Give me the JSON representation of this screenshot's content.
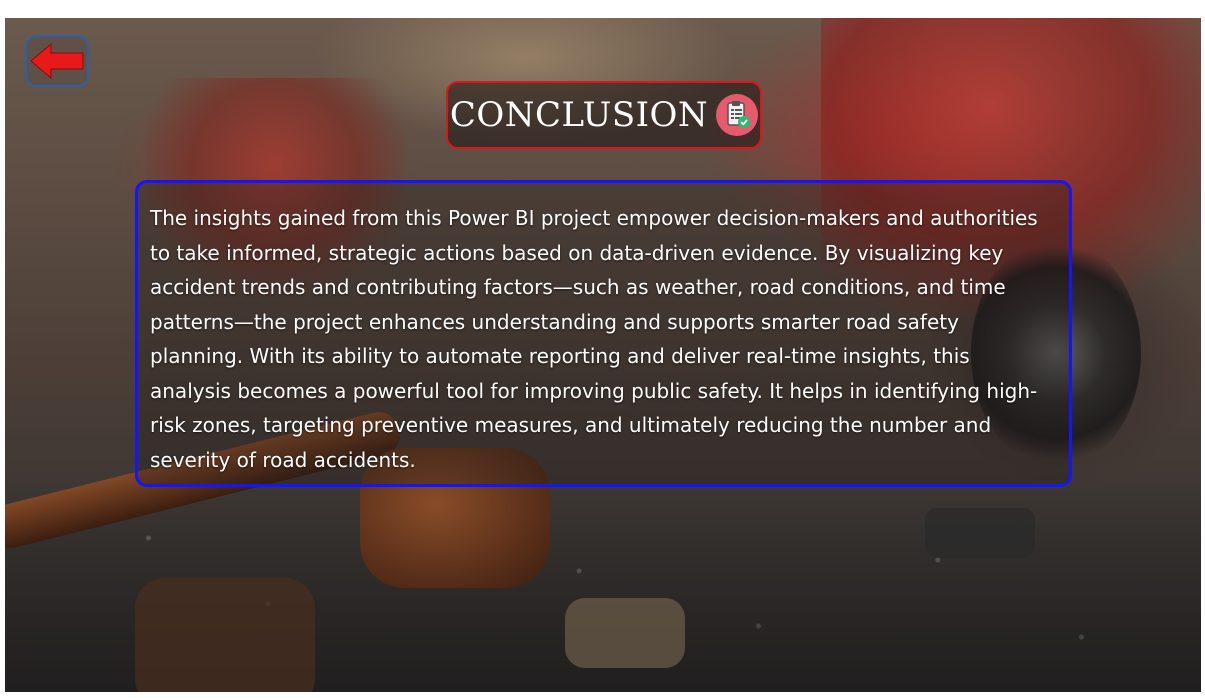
{
  "navigation": {
    "back_icon": "arrow-left-icon",
    "back_icon_color": "#e81919"
  },
  "header": {
    "title": "CONCLUSION",
    "title_icon": "clipboard-check-icon",
    "title_border_color": "#e0141a"
  },
  "content": {
    "paragraph": "The insights gained from this Power BI project empower decision-makers and authorities to take informed, strategic actions based on data-driven evidence. By visualizing key accident trends and contributing factors—such as weather, road conditions, and time patterns—the project enhances understanding and supports smarter road safety planning. With its ability to automate reporting and deliver real-time insights, this analysis becomes a powerful tool for improving public safety. It helps in identifying high-risk zones, targeting preventive measures, and ultimately reducing the number and severity of road accidents.",
    "panel_border_color": "#1414ff"
  },
  "background": {
    "image_subject": "car-accident-scene-with-gavel"
  }
}
